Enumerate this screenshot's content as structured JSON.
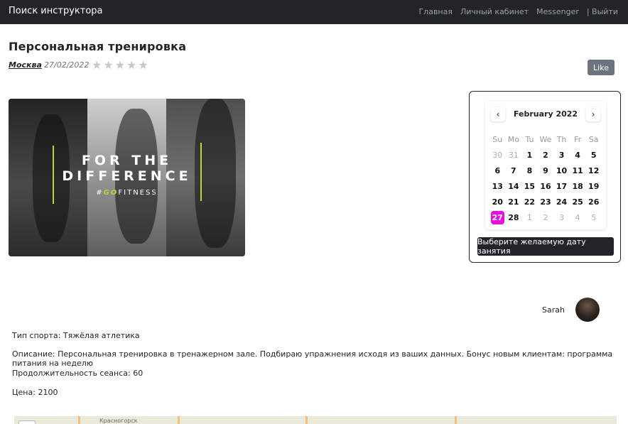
{
  "navbar": {
    "brand": "Поиск инструктора",
    "links": [
      "Главная",
      "Личный кабинет",
      "Messenger",
      "| Выйти"
    ]
  },
  "listing": {
    "title": "Персональная тренировка",
    "city": "Москва",
    "date": "27/02/2022",
    "rating": {
      "value": 0,
      "max": 5
    },
    "like_label": "Like"
  },
  "promo_image": {
    "line1": "FOR THE",
    "line2": "DIFFERENCE",
    "hashtag_prefix": "#",
    "hashtag_accent": "GO",
    "hashtag_rest": "FITNESS",
    "accent_color": "#b6d93a"
  },
  "calendar": {
    "month_label": "February 2022",
    "prev_icon": "chevron-left-icon",
    "next_icon": "chevron-right-icon",
    "weekdays": [
      "Su",
      "Mo",
      "Tu",
      "We",
      "Th",
      "Fr",
      "Sa"
    ],
    "days": [
      {
        "d": "30",
        "t": "oth"
      },
      {
        "d": "31",
        "t": "oth"
      },
      {
        "d": "1",
        "t": "cur"
      },
      {
        "d": "2",
        "t": "cur"
      },
      {
        "d": "3",
        "t": "cur"
      },
      {
        "d": "4",
        "t": "cur"
      },
      {
        "d": "5",
        "t": "cur"
      },
      {
        "d": "6",
        "t": "cur"
      },
      {
        "d": "7",
        "t": "cur"
      },
      {
        "d": "8",
        "t": "cur"
      },
      {
        "d": "9",
        "t": "cur"
      },
      {
        "d": "10",
        "t": "cur"
      },
      {
        "d": "11",
        "t": "cur"
      },
      {
        "d": "12",
        "t": "cur"
      },
      {
        "d": "13",
        "t": "cur"
      },
      {
        "d": "14",
        "t": "cur"
      },
      {
        "d": "15",
        "t": "cur"
      },
      {
        "d": "16",
        "t": "cur"
      },
      {
        "d": "17",
        "t": "cur"
      },
      {
        "d": "18",
        "t": "cur"
      },
      {
        "d": "19",
        "t": "cur"
      },
      {
        "d": "20",
        "t": "cur"
      },
      {
        "d": "21",
        "t": "cur"
      },
      {
        "d": "22",
        "t": "cur"
      },
      {
        "d": "23",
        "t": "cur"
      },
      {
        "d": "24",
        "t": "cur"
      },
      {
        "d": "25",
        "t": "cur"
      },
      {
        "d": "26",
        "t": "cur"
      },
      {
        "d": "27",
        "t": "sel"
      },
      {
        "d": "28",
        "t": "cur"
      },
      {
        "d": "1",
        "t": "oth"
      },
      {
        "d": "2",
        "t": "oth"
      },
      {
        "d": "3",
        "t": "oth"
      },
      {
        "d": "4",
        "t": "oth"
      },
      {
        "d": "5",
        "t": "oth"
      }
    ],
    "selected_color": "#e80ee0",
    "button_label": "Выберите желаемую дату занятия"
  },
  "instructor": {
    "name": "Sarah"
  },
  "details": {
    "sport": "Тип спорта: Тяжёлая атлетика",
    "description": "Описание: Персональная тренировка в тренажерном зале. Подбираю упражнения исходя из ваших данных. Бонус новым клиентам: программа питания на неделю",
    "duration": "Продолжительность сеанса: 60",
    "price": "Цена: 2100"
  },
  "map": {
    "label": "Красногорск"
  }
}
